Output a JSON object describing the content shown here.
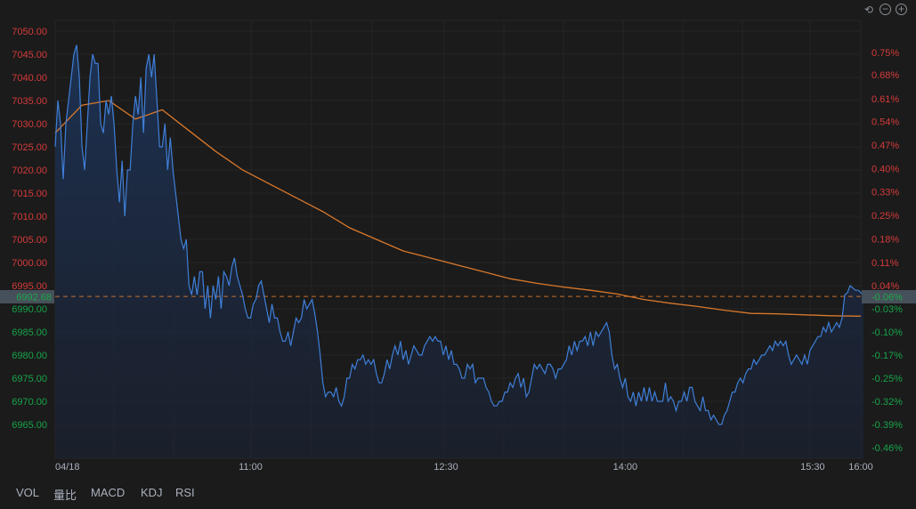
{
  "controls": {
    "reset_icon": "undo-icon",
    "zoom_out_icon": "zoom-out-icon",
    "zoom_in_icon": "zoom-in-icon"
  },
  "indicator_tabs": [
    "VOL",
    "量比",
    "MACD",
    "KDJ",
    "RSI"
  ],
  "colors": {
    "up": "#d63a3a",
    "down": "#17a44a",
    "price_line": "#3f7fd8",
    "avg_line": "#d9782b",
    "grid": "#262626",
    "background": "#1b1b1b"
  },
  "chart_data": {
    "type": "line",
    "title": "",
    "date_label": "04/18",
    "prev_close": 6992.68,
    "prev_close_label": "6992.68",
    "current_pct_label": "-0.06%",
    "ylim": [
      6960,
      7052
    ],
    "y_ticks": [
      "7050.00",
      "7045.00",
      "7040.00",
      "7035.00",
      "7030.00",
      "7025.00",
      "7020.00",
      "7015.00",
      "7010.00",
      "7005.00",
      "7000.00",
      "6995.00",
      "6990.00",
      "6985.00",
      "6980.00",
      "6975.00",
      "6970.00",
      "6965.00"
    ],
    "y_tick_values": [
      7050,
      7045,
      7040,
      7035,
      7030,
      7025,
      7020,
      7015,
      7010,
      7005,
      7000,
      6995,
      6990,
      6985,
      6980,
      6975,
      6970,
      6965
    ],
    "pct_ticks": [
      {
        "label": "0.75%",
        "value": 7045.4,
        "up": true
      },
      {
        "label": "0.68%",
        "value": 7040.6,
        "up": true
      },
      {
        "label": "0.61%",
        "value": 7035.4,
        "up": true
      },
      {
        "label": "0.54%",
        "value": 7030.5,
        "up": true
      },
      {
        "label": "0.47%",
        "value": 7025.4,
        "up": true
      },
      {
        "label": "0.40%",
        "value": 7020.3,
        "up": true
      },
      {
        "label": "0.33%",
        "value": 7015.3,
        "up": true
      },
      {
        "label": "0.25%",
        "value": 7010.2,
        "up": true
      },
      {
        "label": "0.18%",
        "value": 7005.1,
        "up": true
      },
      {
        "label": "0.11%",
        "value": 7000.0,
        "up": true
      },
      {
        "label": "0.04%",
        "value": 6995.0,
        "up": true
      },
      {
        "label": "-0.03%",
        "value": 6990.0,
        "up": false
      },
      {
        "label": "-0.10%",
        "value": 6985.0,
        "up": false
      },
      {
        "label": "-0.17%",
        "value": 6980.0,
        "up": false
      },
      {
        "label": "-0.25%",
        "value": 6975.0,
        "up": false
      },
      {
        "label": "-0.32%",
        "value": 6970.0,
        "up": false
      },
      {
        "label": "-0.39%",
        "value": 6965.0,
        "up": false
      },
      {
        "label": "-0.46%",
        "value": 6960.0,
        "up": false
      }
    ],
    "x_ticks": [
      {
        "label": "11:00",
        "index": 73
      },
      {
        "label": "12:30",
        "index": 146
      },
      {
        "label": "14:00",
        "index": 213
      },
      {
        "label": "15:30",
        "index": 283
      },
      {
        "label": "16:00",
        "index": 301
      }
    ],
    "n_points": 302,
    "price": [
      7025,
      7035,
      7030,
      7018,
      7030,
      7035,
      7040,
      7045,
      7047,
      7040,
      7025,
      7020,
      7030,
      7040,
      7045,
      7043,
      7043,
      7030,
      7028,
      7035,
      7032,
      7036,
      7030,
      7020,
      7013,
      7022,
      7010,
      7020,
      7020,
      7030,
      7036,
      7032,
      7040,
      7028,
      7042,
      7045,
      7040,
      7045,
      7035,
      7025,
      7025,
      7030,
      7020,
      7027,
      7020,
      7015,
      7010,
      7005,
      7003,
      7005,
      6995,
      6993,
      6997,
      6993,
      6998,
      6998,
      6990,
      6995,
      6988,
      6995,
      6992,
      6997,
      6990,
      6998,
      6997,
      6995,
      6999,
      7001,
      6997,
      6995,
      6993,
      6990,
      6988,
      6988,
      6991,
      6992,
      6995,
      6996,
      6993,
      6990,
      6987,
      6991,
      6988,
      6988,
      6985,
      6983,
      6983,
      6985,
      6982,
      6985,
      6988,
      6987,
      6988,
      6992,
      6990,
      6991,
      6992,
      6989,
      6985,
      6980,
      6974,
      6971,
      6972,
      6972,
      6971,
      6973,
      6970,
      6969,
      6971,
      6975,
      6975,
      6978,
      6977,
      6979,
      6979,
      6980,
      6978,
      6979,
      6978,
      6979,
      6976,
      6974,
      6974,
      6976,
      6979,
      6977,
      6980,
      6982,
      6980,
      6983,
      6979,
      6981,
      6978,
      6980,
      6982,
      6981,
      6980,
      6980,
      6982,
      6983,
      6984,
      6983,
      6984,
      6983,
      6983,
      6980,
      6982,
      6979,
      6981,
      6978,
      6978,
      6977,
      6975,
      6975,
      6978,
      6977,
      6978,
      6974,
      6975,
      6975,
      6975,
      6973,
      6972,
      6970,
      6969,
      6969,
      6970,
      6970,
      6972,
      6972,
      6974,
      6973,
      6975,
      6976,
      6973,
      6975,
      6971,
      6972,
      6975,
      6978,
      6977,
      6978,
      6977,
      6976,
      6978,
      6978,
      6977,
      6975,
      6977,
      6977,
      6978,
      6979,
      6982,
      6980,
      6983,
      6981,
      6983,
      6983,
      6984,
      6982,
      6985,
      6982,
      6985,
      6984,
      6985,
      6986,
      6987,
      6985,
      6980,
      6977,
      6978,
      6975,
      6973,
      6975,
      6971,
      6970,
      6972,
      6969,
      6972,
      6970,
      6973,
      6970,
      6973,
      6970,
      6972,
      6970,
      6970,
      6970,
      6974,
      6970,
      6971,
      6970,
      6968,
      6970,
      6970,
      6972,
      6970,
      6973,
      6973,
      6970,
      6969,
      6968,
      6971,
      6968,
      6968,
      6966,
      6967,
      6966,
      6965,
      6965,
      6967,
      6968,
      6970,
      6972,
      6972,
      6974,
      6975,
      6974,
      6976,
      6977,
      6977,
      6979,
      6978,
      6979,
      6980,
      6980,
      6981,
      6982,
      6981,
      6983,
      6982,
      6983,
      6982,
      6983,
      6980,
      6978,
      6979,
      6980,
      6979,
      6978,
      6980,
      6978,
      6981,
      6982,
      6983,
      6984,
      6984,
      6986,
      6985,
      6987,
      6985,
      6986,
      6987,
      6986,
      6988,
      6993,
      6993.5,
      6995,
      6994.5,
      6994,
      6994,
      6993.5,
      6993
    ],
    "avg_every": 10,
    "avg": [
      7028,
      7034,
      7035,
      7031,
      7033,
      7028.5,
      7024,
      7020,
      7017,
      7014,
      7011,
      7007.5,
      7005,
      7002.5,
      7001,
      6999.5,
      6998,
      6996.5,
      6995.5,
      6994.7,
      6994,
      6993.2,
      6992,
      6991.2,
      6990.5,
      6989.7,
      6989,
      6988.9,
      6988.7,
      6988.5,
      6988.4
    ]
  }
}
